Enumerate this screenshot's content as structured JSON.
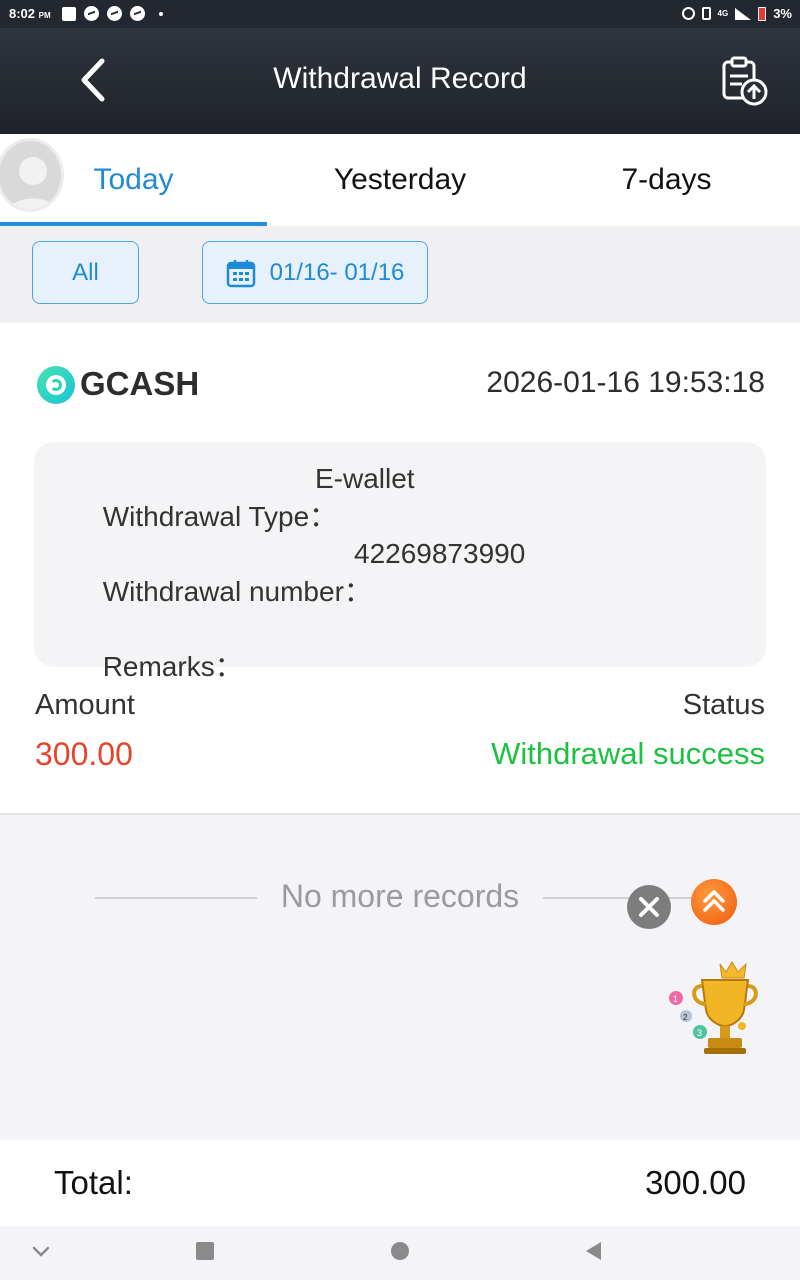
{
  "status_bar": {
    "time": "8:02",
    "ampm": "PM",
    "network": "4G",
    "battery": "3%"
  },
  "header": {
    "title": "Withdrawal Record"
  },
  "tabs": [
    {
      "label": "Today",
      "active": true
    },
    {
      "label": "Yesterday",
      "active": false
    },
    {
      "label": "7-days",
      "active": false
    }
  ],
  "filters": {
    "all_label": "All",
    "date_range": "01/16- 01/16"
  },
  "record": {
    "provider": "GCASH",
    "datetime": "2026-01-16 19:53:18",
    "type_label": "Withdrawal Type：",
    "type_value": "E-wallet",
    "number_label": "Withdrawal number：",
    "number_value": "42269873990",
    "remarks_label": "Remarks：",
    "remarks_value": "",
    "amount_label": "Amount",
    "amount_value": "300.00",
    "status_label": "Status",
    "status_value": "Withdrawal success"
  },
  "list_footer": {
    "no_more": "No more records"
  },
  "total": {
    "label": "Total:",
    "value": "300.00"
  },
  "colors": {
    "header_bg": "#23272f",
    "accent": "#1f8ad8",
    "amount": "#e8442b",
    "success": "#1dc142"
  }
}
